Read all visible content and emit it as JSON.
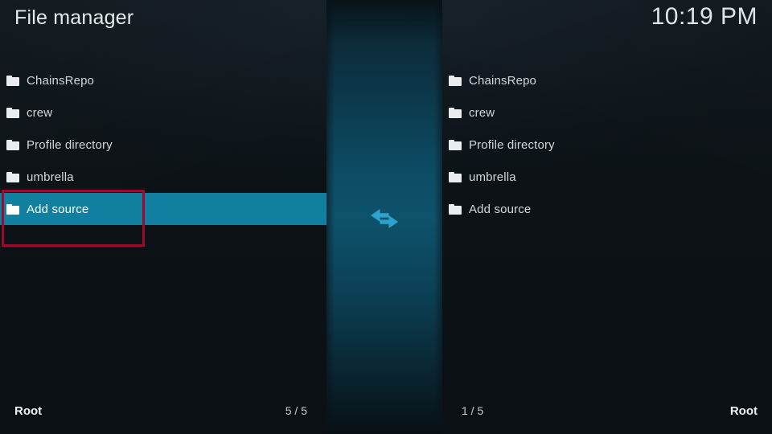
{
  "header": {
    "title": "File manager",
    "clock": "10:19 PM"
  },
  "colors": {
    "background": "#0d1317",
    "highlight": "#1180a0",
    "center_band": "#0d4a62",
    "annotation": "#9d0b2b",
    "text": "#d2d8db",
    "swap_arrow": "#2ba3cc"
  },
  "left_panel": {
    "items": [
      {
        "label": "ChainsRepo",
        "icon": "folder-icon",
        "selected": false
      },
      {
        "label": "crew",
        "icon": "folder-icon",
        "selected": false
      },
      {
        "label": "Profile directory",
        "icon": "folder-icon",
        "selected": false
      },
      {
        "label": "umbrella",
        "icon": "folder-icon",
        "selected": false
      },
      {
        "label": "Add source",
        "icon": "folder-icon",
        "selected": true
      }
    ],
    "footer": {
      "path": "Root",
      "count": "5 / 5"
    }
  },
  "right_panel": {
    "items": [
      {
        "label": "ChainsRepo",
        "icon": "folder-icon",
        "selected": false
      },
      {
        "label": "crew",
        "icon": "folder-icon",
        "selected": false
      },
      {
        "label": "Profile directory",
        "icon": "folder-icon",
        "selected": false
      },
      {
        "label": "umbrella",
        "icon": "folder-icon",
        "selected": false
      },
      {
        "label": "Add source",
        "icon": "folder-icon",
        "selected": false
      }
    ],
    "footer": {
      "path": "Root",
      "count": "1 / 5"
    }
  },
  "center": {
    "icon": "swap-horizontal-arrows-icon"
  }
}
